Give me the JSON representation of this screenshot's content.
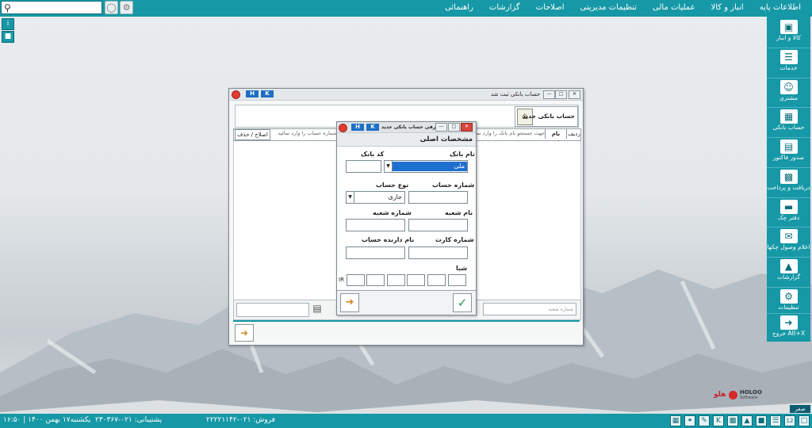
{
  "search": {
    "value": "",
    "placeholder": ""
  },
  "menu": [
    "اطلاعات پایه",
    "انبار و کالا",
    "عملیات مالی",
    "تنظیمات مدیریتی",
    "اصلاحات",
    "گزارشات",
    "راهنمائی"
  ],
  "sidebar": [
    {
      "label": "کالا و انبار",
      "icon": "box-icon"
    },
    {
      "label": "خدمات",
      "icon": "services-icon"
    },
    {
      "label": "مشتری",
      "icon": "customer-icon"
    },
    {
      "label": "حساب بانکی",
      "icon": "bank-account-icon"
    },
    {
      "label": "صدور فاکتور",
      "icon": "invoice-icon"
    },
    {
      "label": "دریافت و پرداخت",
      "icon": "payment-icon"
    },
    {
      "label": "دفتر چک",
      "icon": "checkbook-icon"
    },
    {
      "label": "اعلام وصول چکها",
      "icon": "check-collect-icon"
    },
    {
      "label": "گزارشات",
      "icon": "report-icon"
    },
    {
      "label": "تنظیمات",
      "icon": "settings-icon"
    },
    {
      "label": "خروج Alt+X",
      "icon": "exit-icon"
    }
  ],
  "bank_list_window": {
    "title": "حساب بانکی ثبت شد",
    "h": "H",
    "k": "K",
    "new_button": "حساب بانکی جدید",
    "col_row": "ردیف",
    "col_bank": "نام بانک",
    "bank_search_placeholder": "جهت جستجو نام بانک را وارد نمائید",
    "account_search_placeholder": "جهت جستجو شماره حساب را وارد نمائید",
    "edit_delete": "اصلاح / حذف",
    "branch_number_placeholder": "شماره شعبه"
  },
  "new_account_dialog": {
    "title": "معرفی حساب بانکی جدید",
    "h": "H",
    "k": "K",
    "section": "مشخصات اصلی",
    "bank_name_label": "نام بانک",
    "bank_name_value": "ملی",
    "bank_code_label": "کد بانک",
    "bank_code_value": "",
    "account_number_label": "شماره حساب",
    "account_type_label": "نوع حساب",
    "account_type_value": "جاری",
    "branch_name_label": "نام شعبه",
    "branch_number_label": "شماره شعبه",
    "card_number_label": "شماره کارت",
    "holder_name_label": "نام دارنده حساب",
    "sheba_label": "شبا",
    "ir_prefix": "IR"
  },
  "logo": {
    "brand": "HOLOO",
    "sub": "Software",
    "mark": "هلو"
  },
  "currency": "صفر ریال",
  "status": {
    "datetime": "یکشنبه۱۷ بهمن ۱۴۰۰ | ۱۶:۵۰",
    "support": "پشتیبانی: ۰۲۱-۲۳۰۳۶۷",
    "sales": "فروش: ۰۲۱-۲۲۲۲۱۱۴۲",
    "badge_12": "12"
  }
}
